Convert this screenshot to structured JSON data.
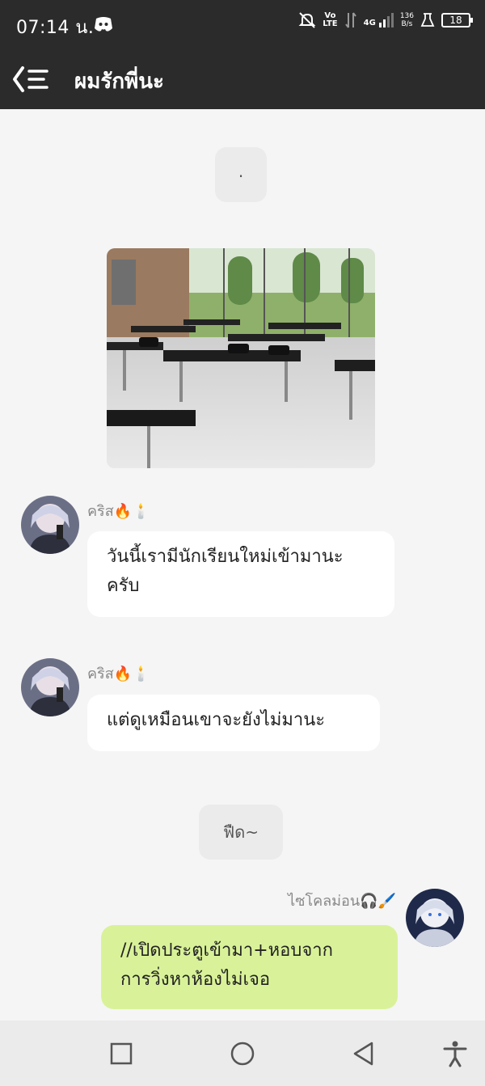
{
  "status_bar": {
    "time": "07:14 น.",
    "network_top": "Vo",
    "network_bottom": "LTE",
    "signal_label": "4G",
    "speed_value": "136",
    "speed_unit": "B/s",
    "battery": "18"
  },
  "header": {
    "title": "ผมรักพี่นะ"
  },
  "messages": {
    "system_dot": ".",
    "msg1_sender": "คริส🔥🕯️",
    "msg1_text_line1": "วันนี้เรามีนักเรียนใหม่เข้ามานะ",
    "msg1_text_line2": "ครับ",
    "msg2_sender": "คริส🔥🕯️",
    "msg2_text": "แต่ดูเหมือนเขาจะยังไม่มานะ",
    "system_sigh": "ฟืด~",
    "msg3_sender": "ไซโคลม่อน🎧🖌️",
    "msg3_text_line1": "//เปิดประตูเข้ามา+หอบจาก",
    "msg3_text_line2": "การวิ่งหาห้องไม่เจอ"
  },
  "colors": {
    "header_bg": "#2b2b2b",
    "chat_bg": "#f5f5f5",
    "my_bubble": "#d9f299",
    "other_bubble": "#ffffff"
  }
}
